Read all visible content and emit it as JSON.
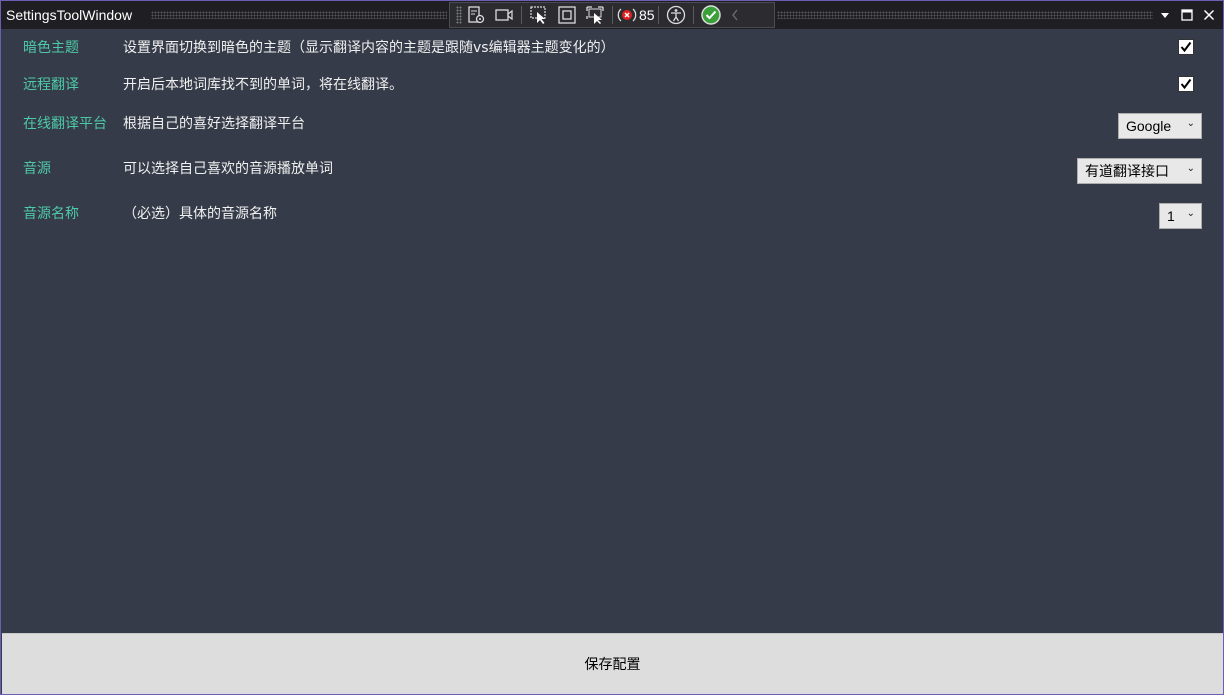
{
  "window": {
    "title": "SettingsToolWindow"
  },
  "toolbar": {
    "items": [
      {
        "icon": "live-visual-tree-icon"
      },
      {
        "icon": "record-video-icon"
      },
      {
        "icon": "select-element-icon"
      },
      {
        "icon": "display-layout-adorners-icon"
      },
      {
        "icon": "track-focus-icon"
      },
      {
        "icon": "hot-reload-issues-icon"
      },
      {
        "icon": "accessibility-icon"
      },
      {
        "icon": "check-status-icon"
      },
      {
        "icon": "collapse-chevron-icon"
      }
    ],
    "issue_count": "85"
  },
  "settings": [
    {
      "label": "暗色主题",
      "desc": "设置界面切换到暗色的主题（显示翻译内容的主题是跟随vs编辑器主题变化的）",
      "control": "checkbox",
      "checked": true
    },
    {
      "label": "远程翻译",
      "desc": "开启后本地词库找不到的单词，将在线翻译。",
      "control": "checkbox",
      "checked": true
    },
    {
      "label": "在线翻译平台",
      "desc": "根据自己的喜好选择翻译平台",
      "control": "select",
      "value": "Google"
    },
    {
      "label": "音源",
      "desc": "可以选择自己喜欢的音源播放单词",
      "control": "select",
      "value": "有道翻译接口"
    },
    {
      "label": "音源名称",
      "desc": "（必选）具体的音源名称",
      "control": "select",
      "value": "1"
    }
  ],
  "footer": {
    "save_label": "保存配置"
  },
  "colors": {
    "background": "#353b48",
    "label_accent": "#4ec9a8",
    "titlebar": "#1f1f23",
    "footer": "#dddddd"
  }
}
